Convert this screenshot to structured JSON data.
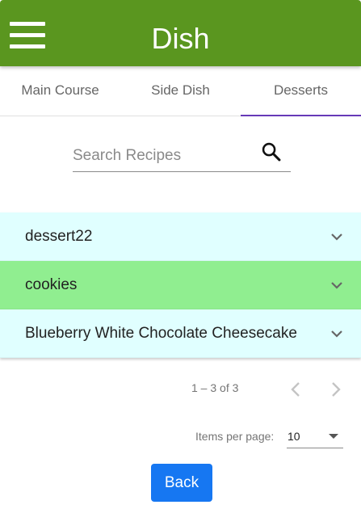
{
  "header": {
    "title": "Dish"
  },
  "tabs": [
    {
      "label": "Main Course"
    },
    {
      "label": "Side Dish"
    },
    {
      "label": "Desserts"
    }
  ],
  "active_tab_index": 2,
  "search": {
    "placeholder": "Search Recipes",
    "value": ""
  },
  "recipes": [
    {
      "name": "dessert22",
      "bg": "#e0ffff"
    },
    {
      "name": "cookies",
      "bg": "#90ee90"
    },
    {
      "name": "Blueberry White Chocolate Cheesecake",
      "bg": "#e0ffff"
    }
  ],
  "paginator": {
    "range_label": "1 – 3 of 3",
    "items_per_page_label": "Items per page:",
    "items_per_page_value": "10"
  },
  "back_label": "Back",
  "colors": {
    "toolbar": "#5a961f",
    "tab_indicator": "#673ab7",
    "back_button": "#1677f2"
  }
}
